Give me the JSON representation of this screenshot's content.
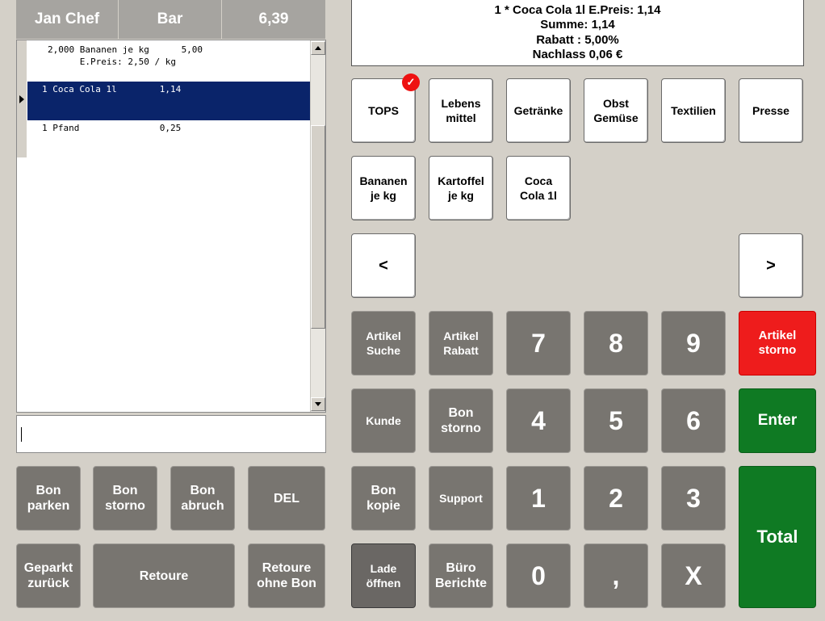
{
  "header": {
    "user": "Jan Chef",
    "mode": "Bar",
    "total": "6,39"
  },
  "receipt": {
    "rows": [
      "2,000 Bananen je kg      5,00",
      "      E.Preis: 2,50 / kg",
      "1 Coca Cola 1l        1,14",
      "1 Pfand               0,25"
    ]
  },
  "info": {
    "line1": "1 * Coca Cola 1l E.Preis: 1,14",
    "line2": "Summe: 1,14",
    "line3": "Rabatt : 5,00%",
    "line4": "Nachlass 0,06 €"
  },
  "categories": [
    "TOPS",
    "Lebens\nmittel",
    "Getränke",
    "Obst\nGemüse",
    "Textilien",
    "Presse"
  ],
  "products": [
    "Bananen\nje kg",
    "Kartoffel\nje kg",
    "Coca\nCola 1l"
  ],
  "nav": {
    "prev": "<",
    "next": ">"
  },
  "functions": {
    "artikel_suche": "Artikel\nSuche",
    "artikel_rabatt": "Artikel\nRabatt",
    "kunde": "Kunde",
    "bon_storno_right": "Bon\nstorno",
    "bon_kopie": "Bon\nkopie",
    "support": "Support",
    "lade_oeffnen": "Lade\nöffnen",
    "buero_berichte": "Büro\nBerichte",
    "artikel_storno": "Artikel\nstorno",
    "enter": "Enter",
    "total": "Total"
  },
  "keypad": {
    "k7": "7",
    "k8": "8",
    "k9": "9",
    "k4": "4",
    "k5": "5",
    "k6": "6",
    "k1": "1",
    "k2": "2",
    "k3": "3",
    "k0": "0",
    "comma": ",",
    "x": "X"
  },
  "bottom": {
    "bon_parken": "Bon\nparken",
    "bon_storno": "Bon\nstorno",
    "bon_abbruch": "Bon\nabruch",
    "del": "DEL",
    "geparkt_zurueck": "Geparkt\nzurück",
    "retoure": "Retoure",
    "retoure_ohne_bon": "Retoure\nohne Bon"
  },
  "colors": {
    "background": "#d4d0c8",
    "header": "#a6a4a0",
    "selection": "#0a246a",
    "grey_button": "#787570",
    "storno": "#ee1c1c",
    "enter": "#0f7a23",
    "badge": "#e11111"
  },
  "badge_icon": "check-badge-icon"
}
